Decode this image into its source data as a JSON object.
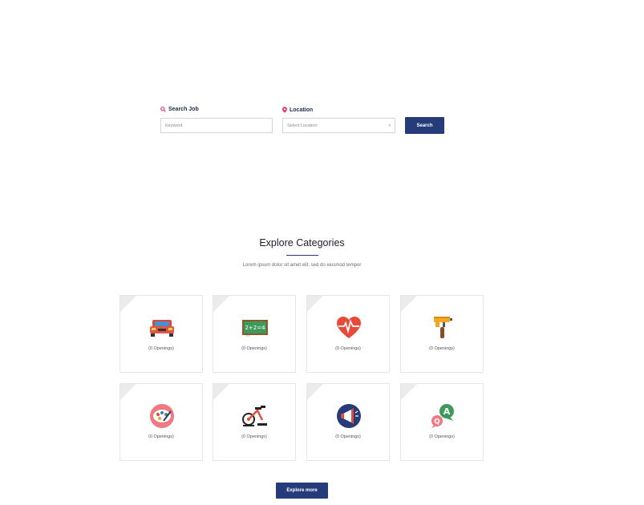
{
  "search": {
    "job_label": "Search Job",
    "keyword_placeholder": "Keyword",
    "location_label": "Location",
    "location_placeholder": "Select Location",
    "button_label": "Search"
  },
  "categories": {
    "title": "Explore Categories",
    "subtitle": "Lorem ipsum dolor sit amet elit, sed do eiusmod tempor",
    "items": [
      {
        "icon": "car-icon",
        "count_text": "(0 Openings)"
      },
      {
        "icon": "chalkboard-icon",
        "count_text": "(0 Openings)"
      },
      {
        "icon": "heart-pulse-icon",
        "count_text": "(0 Openings)"
      },
      {
        "icon": "paint-roller-icon",
        "count_text": "(0 Openings)"
      },
      {
        "icon": "palette-icon",
        "count_text": "(0 Openings)"
      },
      {
        "icon": "exercise-bike-icon",
        "count_text": "(0 Openings)"
      },
      {
        "icon": "megaphone-icon",
        "count_text": "(0 Openings)"
      },
      {
        "icon": "qa-bubbles-icon",
        "count_text": "(0 Openings)"
      }
    ],
    "chalkboard_text": "2+2=4",
    "qa_letters": [
      "A",
      "Q"
    ],
    "explore_button": "Explore more"
  },
  "colors": {
    "primary": "#263c7a",
    "accent_pink": "#e8386a",
    "border": "#e6e6e6"
  }
}
